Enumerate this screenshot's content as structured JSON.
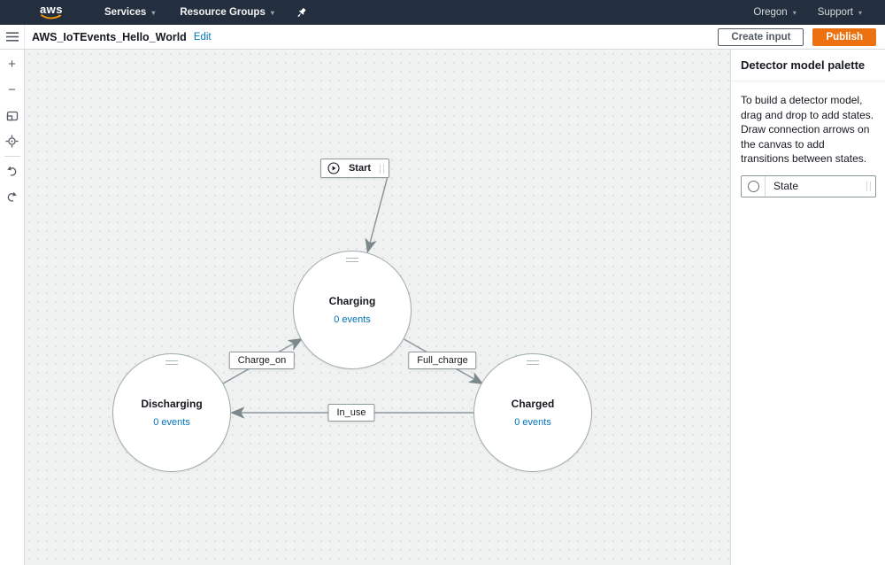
{
  "colors": {
    "topnav_bg": "#232f3e",
    "aws_orange": "#ff9900",
    "publish_orange": "#ec7211",
    "link_blue": "#0073bb",
    "text_dark": "#16191f",
    "edge_gray": "#8a989d"
  },
  "icons": {
    "caret_down": "▾",
    "plus": "+",
    "minus": "−"
  },
  "topnav": {
    "logo_text": "aws",
    "services_label": "Services",
    "resource_groups_label": "Resource Groups",
    "region_label": "Oregon",
    "support_label": "Support"
  },
  "header": {
    "title": "AWS_IoTEvents_Hello_World",
    "edit_label": "Edit",
    "create_input_label": "Create input",
    "publish_label": "Publish"
  },
  "canvas": {
    "start_node": {
      "label": "Start"
    },
    "states": [
      {
        "name": "Charging",
        "events": "0 events"
      },
      {
        "name": "Discharging",
        "events": "0 events"
      },
      {
        "name": "Charged",
        "events": "0 events"
      }
    ],
    "transitions": [
      {
        "label": "Charge_on",
        "from": "Discharging",
        "to": "Charging"
      },
      {
        "label": "Full_charge",
        "from": "Charging",
        "to": "Charged"
      },
      {
        "label": "In_use",
        "from": "Charged",
        "to": "Discharging"
      }
    ]
  },
  "palette": {
    "title": "Detector model palette",
    "description": "To build a detector model, drag and drop to add states. Draw connection arrows on the canvas to add transitions between states.",
    "state_item_label": "State"
  }
}
